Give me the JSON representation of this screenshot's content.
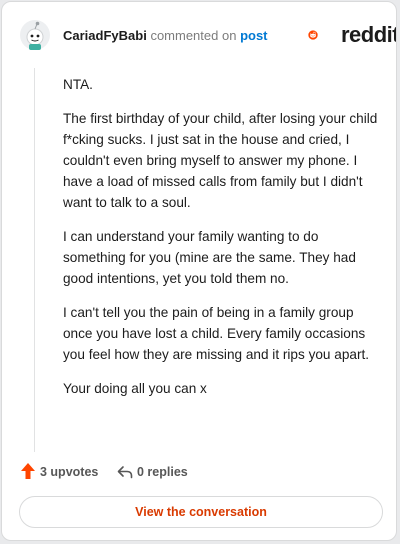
{
  "header": {
    "author": "CariadFyBabi",
    "action_text": "commented on",
    "post_link": "post",
    "brand": "reddit",
    "avatar_icon": "snoo-avatar-icon",
    "brand_icon": "reddit-logo-icon"
  },
  "comment": {
    "paragraphs": [
      "NTA.",
      "The first birthday of your child, after losing your child f*cking sucks. I just sat in the house and cried, I couldn't even bring myself to answer my phone. I have a load of missed calls from family but I didn't want to talk to a soul.",
      "I can understand your family wanting to do something for you (mine are the same. They had good intentions, yet you told them no.",
      "I can't tell you the pain of being in a family group once you have lost a child. Every family occasions you feel how they are missing and it rips you apart.",
      "Your doing all you can x"
    ]
  },
  "actions": {
    "upvotes": "3 upvotes",
    "replies": "0 replies",
    "upvote_icon": "upvote-arrow-icon",
    "reply_icon": "reply-arrow-icon"
  },
  "cta": {
    "label": "View the conversation"
  },
  "colors": {
    "brand_orange": "#ff4500",
    "link_blue": "#0079d3",
    "cta_text": "#d93a00"
  }
}
